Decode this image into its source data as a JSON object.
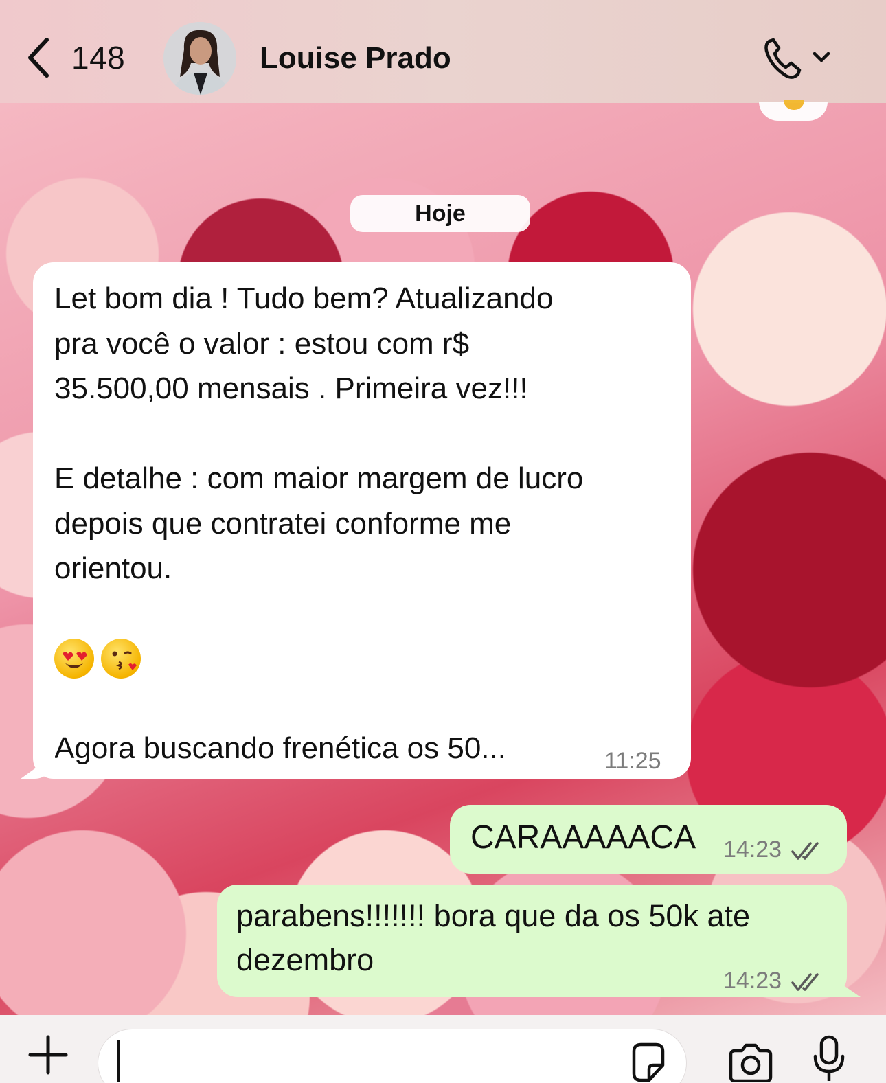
{
  "header": {
    "back_count": "148",
    "contact_name": "Louise Prado"
  },
  "chat": {
    "date_divider": "Hoje",
    "messages": [
      {
        "direction": "incoming",
        "lines": [
          "Let bom dia ! Tudo bem? Atualizando",
          "pra você o valor : estou com r$",
          "35.500,00 mensais . Primeira vez!!!",
          "",
          "E detalhe : com maior margem de lucro",
          "depois que contratei conforme me",
          "orientou.",
          "",
          "",
          "",
          "Agora buscando frenética os 50..."
        ],
        "emojis": [
          "heart-eyes-emoji",
          "kissing-heart-emoji"
        ],
        "time": "11:25"
      },
      {
        "direction": "outgoing",
        "text": "CARAAAAACA",
        "time": "14:23",
        "status": "read"
      },
      {
        "direction": "outgoing",
        "lines": [
          "parabens!!!!!!! bora que da os 50k ate",
          "dezembro"
        ],
        "time": "14:23",
        "status": "read"
      }
    ]
  },
  "input": {
    "value": ""
  },
  "colors": {
    "incoming_bubble": "#ffffff",
    "outgoing_bubble": "#dcfacd",
    "header_bg": "#ead3cf",
    "timestamp": "#7c7c7c"
  }
}
